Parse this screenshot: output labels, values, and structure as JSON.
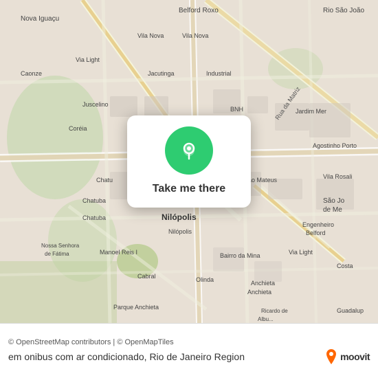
{
  "map": {
    "alt": "Map of Rio de Janeiro region showing Nilópolis area"
  },
  "card": {
    "button_label": "Take me there",
    "pin_icon": "location-pin-icon"
  },
  "bottom": {
    "attribution": "© OpenStreetMap contributors | © OpenMapTiles",
    "route_info": "em onibus com ar condicionado, Rio de Janeiro Region",
    "logo_text": "moovit"
  }
}
